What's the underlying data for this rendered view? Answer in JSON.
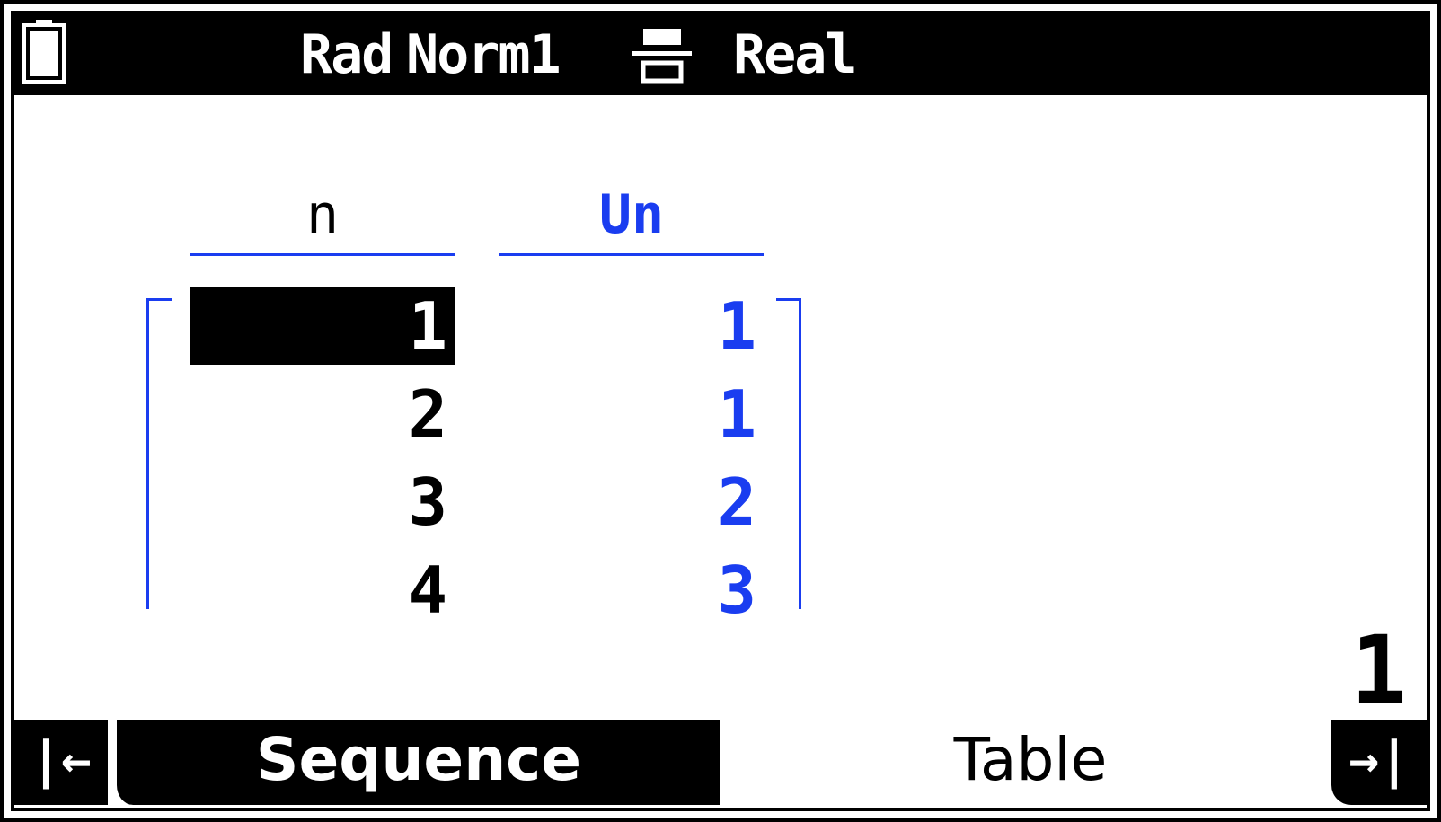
{
  "status_bar": {
    "angle_mode": "Rad",
    "display_mode": "Norm1",
    "fraction_icon": "fraction-format-icon",
    "complex_mode": "Real",
    "battery_icon": "battery-icon"
  },
  "table": {
    "headers": [
      "n",
      "Un"
    ],
    "rows": [
      {
        "n": "1",
        "un": "1"
      },
      {
        "n": "2",
        "un": "1"
      },
      {
        "n": "3",
        "un": "2"
      },
      {
        "n": "4",
        "un": "3"
      }
    ],
    "selected_row": 0
  },
  "cursor_value": "1",
  "function_bar": {
    "left_arrow": "|←",
    "tabs": [
      "Sequence",
      "Table"
    ],
    "active_tab": "Sequence",
    "right_arrow": "→|"
  },
  "colors": {
    "accent": "#1a3df0",
    "foreground": "#000000",
    "background": "#ffffff"
  }
}
